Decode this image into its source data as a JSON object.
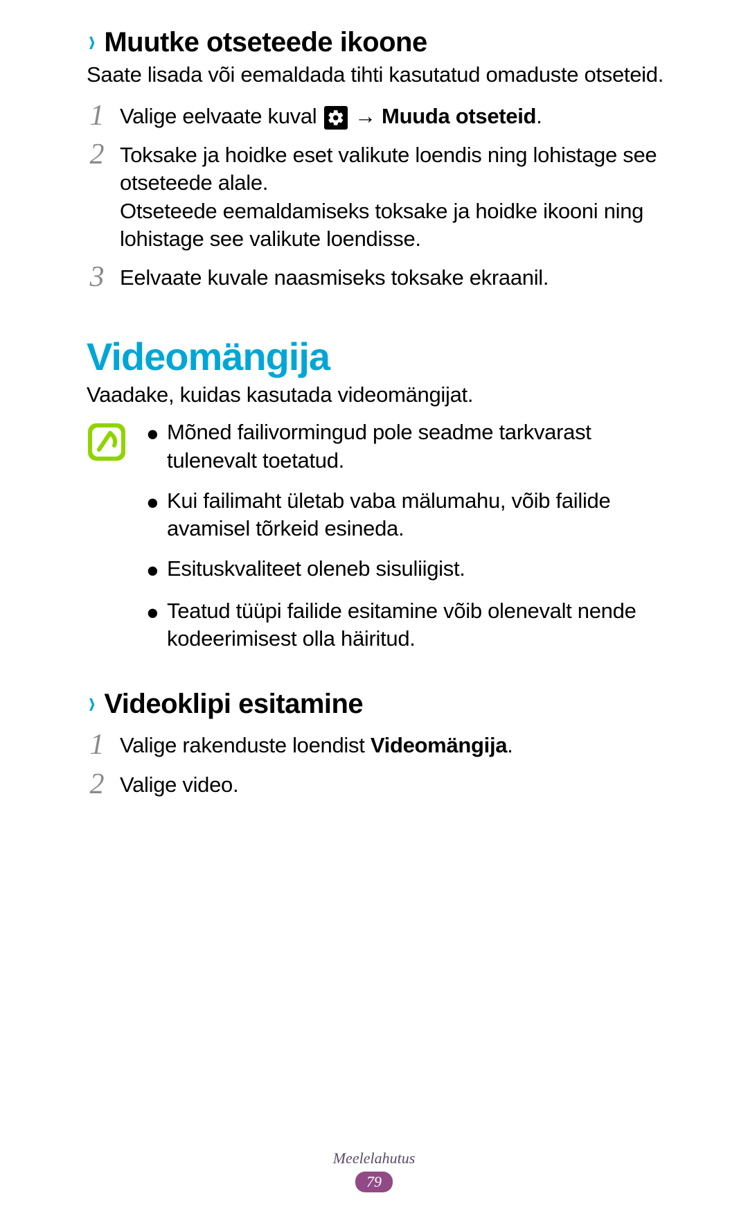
{
  "section1": {
    "heading": "Muutke otseteede ikoone",
    "intro": "Saate lisada või eemaldada tihti kasutatud omaduste otseteid.",
    "steps": {
      "s1": {
        "num": "1",
        "pre": "Valige eelvaate kuval ",
        "arrow": "→",
        "bold": "Muuda otseteid",
        "post": "."
      },
      "s2": {
        "num": "2",
        "line1": "Toksake ja hoidke eset valikute loendis ning lohistage see otseteede alale.",
        "line2": "Otseteede eemaldamiseks toksake ja hoidke ikooni ning lohistage see valikute loendisse."
      },
      "s3": {
        "num": "3",
        "text": "Eelvaate kuvale naasmiseks toksake ekraanil."
      }
    }
  },
  "section2": {
    "heading": "Videomängija",
    "intro": "Vaadake, kuidas kasutada videomängijat.",
    "bullets": {
      "b1": "Mõned failivormingud pole seadme tarkvarast tulenevalt toetatud.",
      "b2": "Kui failimaht ületab vaba mälumahu, võib failide avamisel tõrkeid esineda.",
      "b3": "Esituskvaliteet oleneb sisuliigist.",
      "b4": "Teatud tüüpi failide esitamine võib olenevalt nende kodeerimisest olla häiritud."
    },
    "sub": {
      "heading": "Videoklipi esitamine",
      "s1": {
        "num": "1",
        "pre": "Valige rakenduste loendist ",
        "bold": "Videomängija",
        "post": "."
      },
      "s2": {
        "num": "2",
        "text": "Valige video."
      }
    }
  },
  "footer": {
    "category": "Meelelahutus",
    "page": "79"
  }
}
